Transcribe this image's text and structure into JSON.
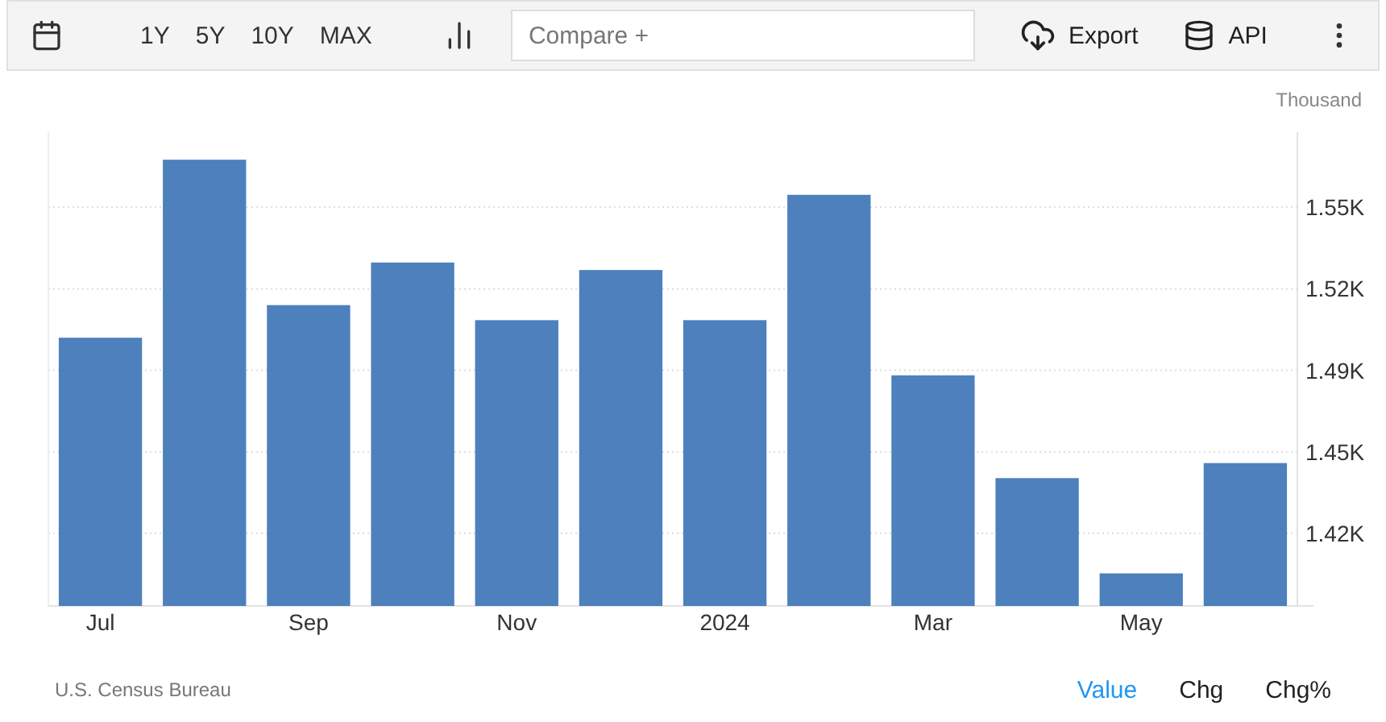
{
  "toolbar": {
    "ranges": [
      {
        "label": "1Y",
        "selected": false
      },
      {
        "label": "5Y",
        "selected": false
      },
      {
        "label": "10Y",
        "selected": false
      },
      {
        "label": "MAX",
        "selected": false
      }
    ],
    "compare": {
      "placeholder": "Compare +"
    },
    "actions": [
      {
        "kind": "export",
        "label": "Export"
      },
      {
        "kind": "api",
        "label": "API"
      }
    ]
  },
  "chart": {
    "unit": "Thousand",
    "chart_data": {
      "type": "bar",
      "categories": [
        "Jul",
        null,
        "Sep",
        null,
        "Nov",
        null,
        "2024",
        null,
        "Mar",
        null,
        "May",
        null
      ],
      "values": [
        1498,
        1569,
        1511,
        1528,
        1505,
        1525,
        1505,
        1555,
        1483,
        1442,
        1404,
        1448
      ],
      "ylim": [
        1391,
        1580
      ],
      "grid": true,
      "yticks": [
        {
          "value": 1550,
          "label": "1.55K"
        },
        {
          "value": 1517.5,
          "label": "1.52K"
        },
        {
          "value": 1485,
          "label": "1.49K"
        },
        {
          "value": 1452.5,
          "label": "1.45K"
        },
        {
          "value": 1420,
          "label": "1.42K"
        }
      ]
    }
  },
  "footer": {
    "source": "U.S. Census Bureau",
    "modes": [
      {
        "label": "Value",
        "selected": true
      },
      {
        "label": "Chg",
        "selected": false
      },
      {
        "label": "Chg%",
        "selected": false
      }
    ]
  }
}
